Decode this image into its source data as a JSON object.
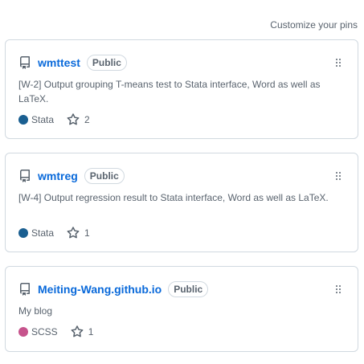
{
  "header": {
    "customize_label": "Customize your pins"
  },
  "pins": [
    {
      "name": "wmttest",
      "visibility": "Public",
      "description": "[W-2] Output grouping T-means test to Stata interface, Word as well as LaTeX.",
      "language": "Stata",
      "language_color": "#1a5f91",
      "stars": "2"
    },
    {
      "name": "wmtreg",
      "visibility": "Public",
      "description": "[W-4] Output regression result to Stata interface, Word as well as LaTeX.",
      "language": "Stata",
      "language_color": "#1a5f91",
      "stars": "1"
    },
    {
      "name": "Meiting-Wang.github.io",
      "visibility": "Public",
      "description": "My blog",
      "language": "SCSS",
      "language_color": "#c6538c",
      "stars": "1"
    }
  ]
}
